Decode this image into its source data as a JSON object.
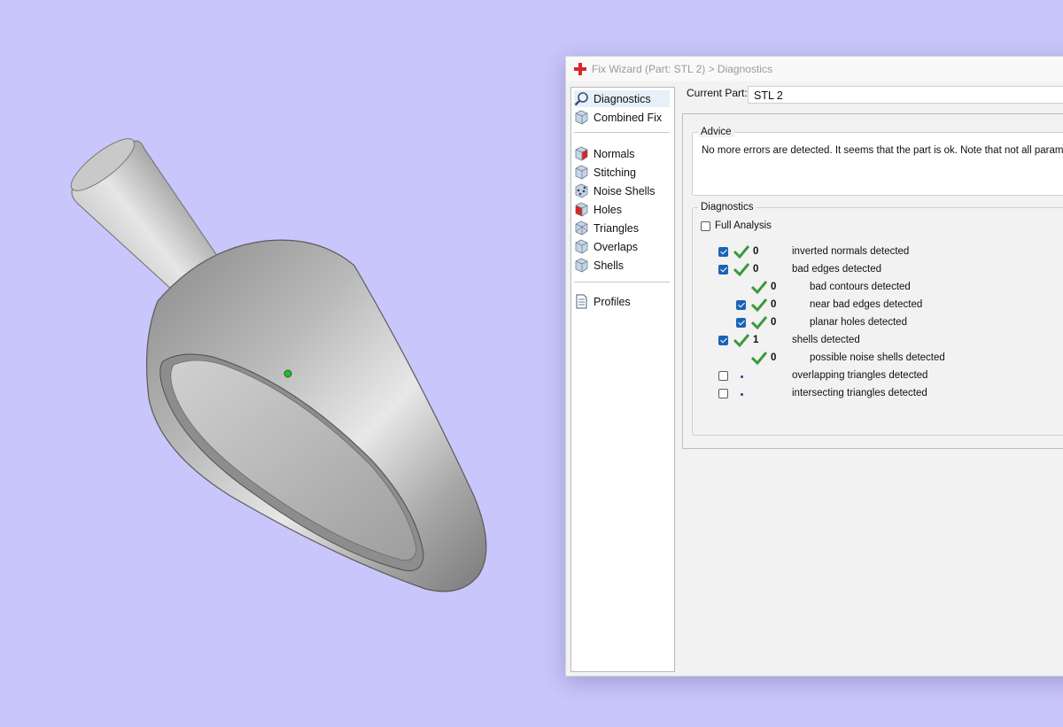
{
  "window": {
    "title": "Fix Wizard (Part: STL 2) > Diagnostics",
    "icon": "red-cross-icon"
  },
  "sidebar": {
    "items": [
      {
        "label": "Diagnostics",
        "icon": "magnifier-icon",
        "active": true
      },
      {
        "label": "Combined Fix",
        "icon": "cube-icon"
      },
      {
        "label": "Normals",
        "icon": "cube-red-face-icon"
      },
      {
        "label": "Stitching",
        "icon": "cube-icon"
      },
      {
        "label": "Noise Shells",
        "icon": "cube-dots-icon"
      },
      {
        "label": "Holes",
        "icon": "cube-red-face-icon"
      },
      {
        "label": "Triangles",
        "icon": "cube-icon"
      },
      {
        "label": "Overlaps",
        "icon": "cube-icon"
      },
      {
        "label": "Shells",
        "icon": "cube-icon"
      },
      {
        "label": "Profiles",
        "icon": "document-icon"
      }
    ]
  },
  "current_part": {
    "label": "Current Part:",
    "value": "STL 2"
  },
  "advice": {
    "title": "Advice",
    "text": "No more errors are detected. It seems that the part is ok. Note that not all parameter"
  },
  "diagnostics": {
    "title": "Diagnostics",
    "full_analysis_label": "Full Analysis",
    "full_analysis_checked": false,
    "rows": [
      {
        "checked": true,
        "has_checkbox": true,
        "ok": true,
        "count": "0",
        "label": "inverted normals detected",
        "indent": 0
      },
      {
        "checked": true,
        "has_checkbox": true,
        "ok": true,
        "count": "0",
        "label": "bad edges detected",
        "indent": 0
      },
      {
        "checked": false,
        "has_checkbox": false,
        "ok": true,
        "count": "0",
        "label": "bad contours detected",
        "indent": 1
      },
      {
        "checked": true,
        "has_checkbox": true,
        "ok": true,
        "count": "0",
        "label": "near bad edges detected",
        "indent": 1
      },
      {
        "checked": true,
        "has_checkbox": true,
        "ok": true,
        "count": "0",
        "label": "planar holes detected",
        "indent": 1
      },
      {
        "checked": true,
        "has_checkbox": true,
        "ok": true,
        "count": "1",
        "label": "shells detected",
        "indent": 0
      },
      {
        "checked": false,
        "has_checkbox": false,
        "ok": true,
        "count": "0",
        "label": "possible noise shells detected",
        "indent": 1
      },
      {
        "checked": false,
        "has_checkbox": true,
        "ok": false,
        "count": "",
        "label": "overlapping triangles detected",
        "indent": 0
      },
      {
        "checked": false,
        "has_checkbox": true,
        "ok": false,
        "count": "",
        "label": "intersecting triangles detected",
        "indent": 0
      }
    ]
  },
  "colors": {
    "background": "#c9c6fb",
    "check_green": "#3a9a3a",
    "checkbox_blue": "#1a63b8",
    "part_gray": "#9d9d9d"
  }
}
